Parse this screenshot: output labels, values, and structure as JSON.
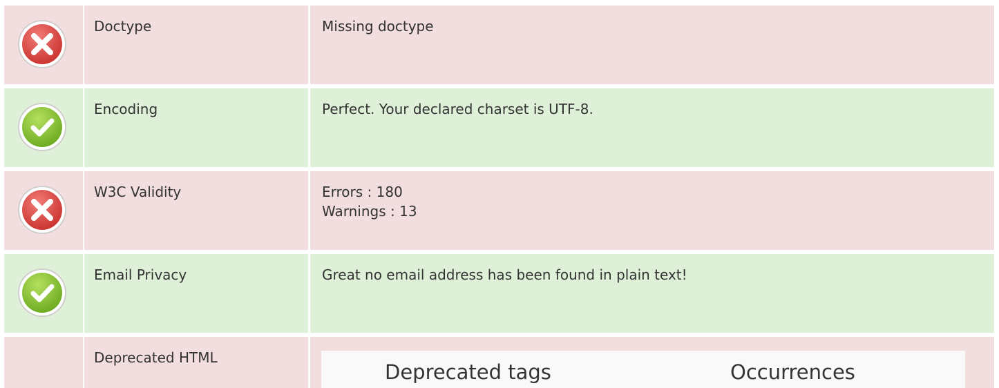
{
  "rows": [
    {
      "status": "error",
      "label": "Doctype",
      "lines": [
        "Missing doctype"
      ]
    },
    {
      "status": "success",
      "label": "Encoding",
      "lines": [
        "Perfect. Your declared charset is UTF-8."
      ]
    },
    {
      "status": "error",
      "label": "W3C Validity",
      "lines": [
        "Errors : 180",
        "Warnings : 13"
      ]
    },
    {
      "status": "success",
      "label": "Email Privacy",
      "lines": [
        "Great no email address has been found in plain text!"
      ]
    }
  ],
  "deprecated": {
    "label": "Deprecated HTML",
    "table_headers": [
      "Deprecated tags",
      "Occurrences"
    ]
  },
  "colors": {
    "error_bg": "#f2dede",
    "success_bg": "#dff0d8",
    "error_icon": "#d9534f",
    "success_icon": "#8cc63f"
  }
}
